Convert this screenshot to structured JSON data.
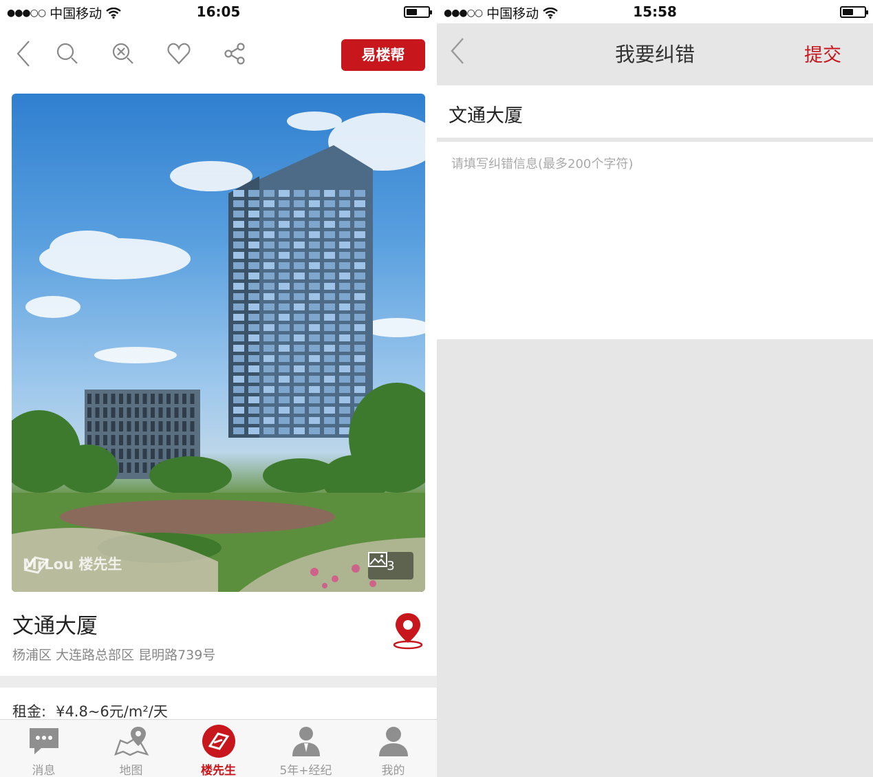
{
  "left": {
    "status_bar": {
      "signal": "●●●○○",
      "carrier": "中国移动",
      "time": "16:05",
      "battery_level": 0.5
    },
    "toolbar": {
      "help_button": "易楼帮",
      "icons": [
        "back-icon",
        "search-icon",
        "zoom-out-icon",
        "heart-icon",
        "share-icon"
      ]
    },
    "photo": {
      "watermark": "MrLou 楼先生",
      "count": "3"
    },
    "building": {
      "name": "文通大厦",
      "address": "杨浦区 大连路总部区 昆明路739号"
    },
    "rent": {
      "label": "租金:",
      "value": "¥4.8~6元/m²/天"
    },
    "tabs": [
      {
        "label": "消息",
        "icon": "message-icon"
      },
      {
        "label": "地图",
        "icon": "map-icon"
      },
      {
        "label": "楼先生",
        "icon": "mrlou-logo-icon",
        "active": true
      },
      {
        "label": "5年+经纪",
        "icon": "agent-icon"
      },
      {
        "label": "我的",
        "icon": "profile-icon"
      }
    ]
  },
  "right": {
    "status_bar": {
      "signal": "●●●○○",
      "carrier": "中国移动",
      "time": "15:58",
      "battery_level": 0.5
    },
    "nav": {
      "title": "我要纠错",
      "submit": "提交"
    },
    "building_name": "文通大厦",
    "error_input": {
      "placeholder": "请填写纠错信息(最多200个字符)",
      "value": ""
    }
  },
  "colors": {
    "brand_red": "#c8161d",
    "divider_gray": "#e6e6e6"
  }
}
